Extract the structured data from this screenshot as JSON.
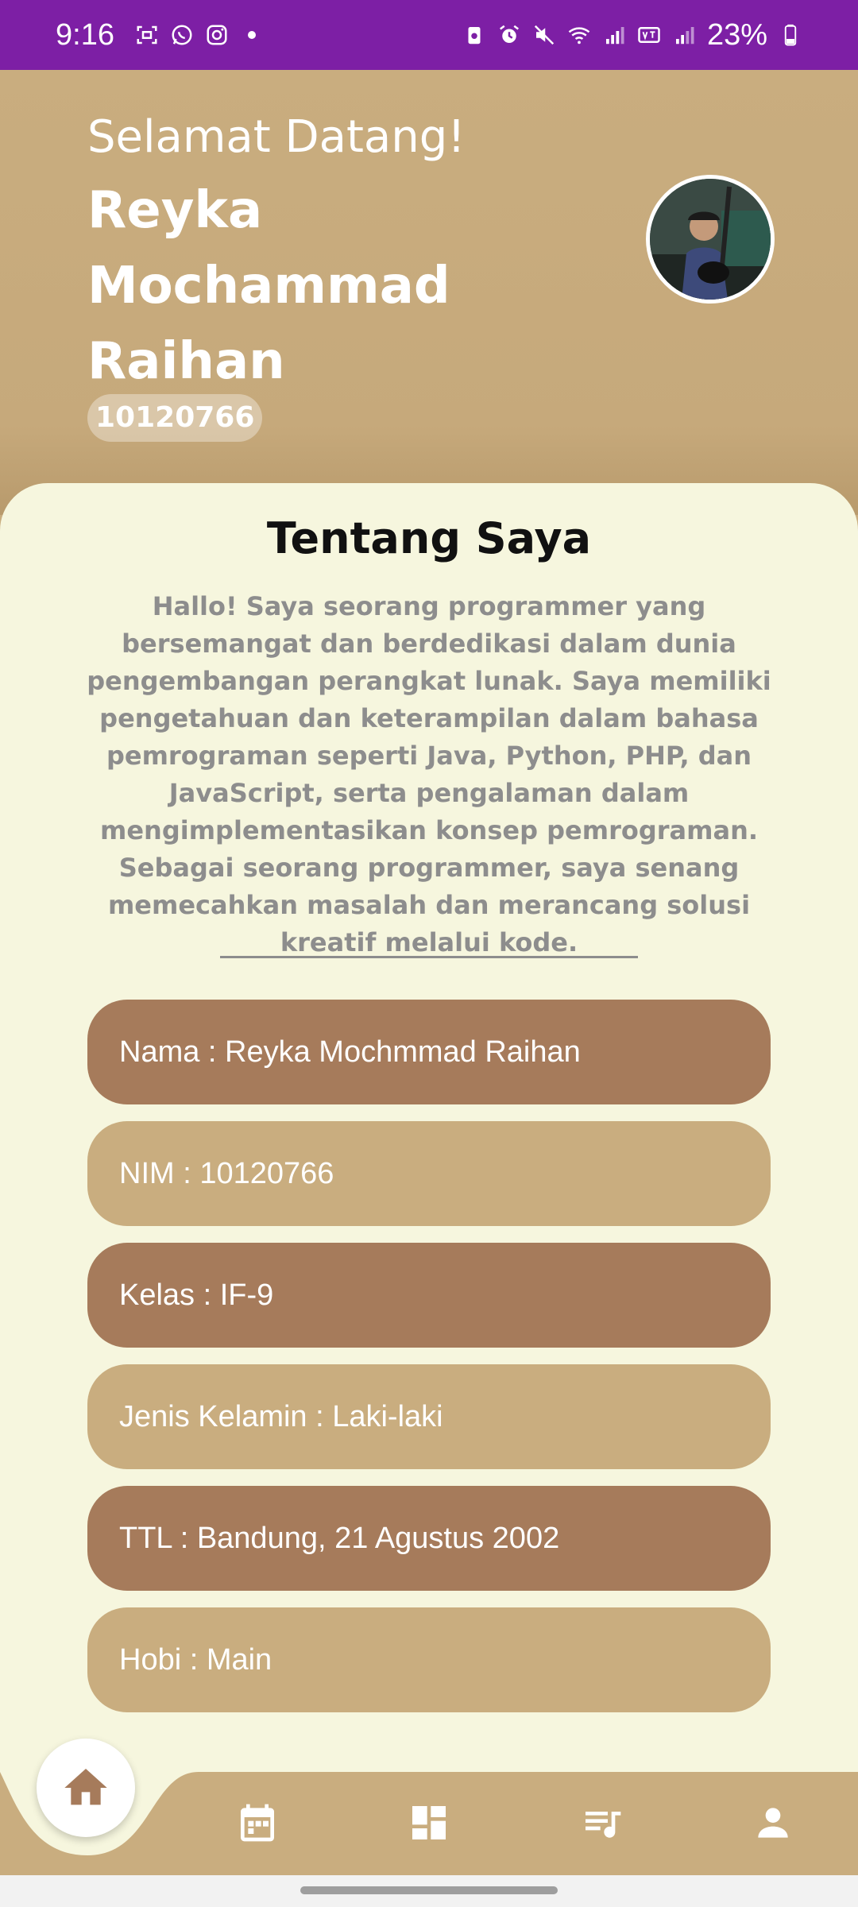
{
  "status_bar": {
    "time": "9:16",
    "battery": "23%",
    "left_icons": [
      "screenshot-icon",
      "whatsapp-icon",
      "instagram-icon",
      "dot-icon"
    ],
    "right_icons": [
      "battery-saver-icon",
      "alarm-icon",
      "mute-icon",
      "wifi-icon",
      "signal-icon",
      "volte-icon",
      "signal-icon",
      "battery-icon"
    ]
  },
  "header": {
    "welcome": "Selamat Datang!",
    "name": "Reyka Mochammad Raihan",
    "nim": "10120766"
  },
  "about": {
    "title": "Tentang Saya",
    "text": "Hallo! Saya seorang programmer yang bersemangat dan berdedikasi dalam dunia pengembangan perangkat lunak. Saya memiliki pengetahuan dan keterampilan dalam bahasa pemrograman seperti Java, Python, PHP, dan JavaScript, serta pengalaman dalam mengimplementasikan konsep pemrograman. Sebagai seorang programmer, saya senang memecahkan masalah dan merancang solusi kreatif melalui kode."
  },
  "info": [
    {
      "label": "Nama : Reyka Mochmmad Raihan",
      "tone": "dark"
    },
    {
      "label": "NIM : 10120766",
      "tone": "light"
    },
    {
      "label": "Kelas : IF-9",
      "tone": "dark"
    },
    {
      "label": "Jenis Kelamin : Laki-laki",
      "tone": "light"
    },
    {
      "label": "TTL : Bandung, 21 Agustus 2002",
      "tone": "dark"
    },
    {
      "label": "Hobi : Main",
      "tone": "light"
    }
  ],
  "nav": {
    "items": [
      "home-icon",
      "calendar-icon",
      "dashboard-icon",
      "playlist-icon",
      "person-icon"
    ],
    "active": "home-icon"
  },
  "colors": {
    "status_bar": "#7d1fa5",
    "header": "#c9ad7f",
    "card": "#f6f6de",
    "dark_item": "#a67b5b",
    "light_item": "#c9ad7f"
  }
}
